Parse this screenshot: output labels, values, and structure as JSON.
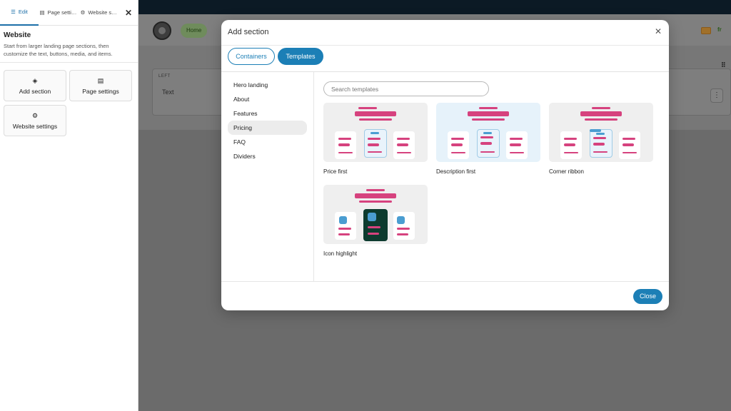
{
  "panel": {
    "tabs": [
      {
        "label": "Edit",
        "icon": "sliders-icon"
      },
      {
        "label": "Page settin...",
        "icon": "file-icon"
      },
      {
        "label": "Website set...",
        "icon": "gear-icon"
      }
    ],
    "close_label": "✕",
    "section_title": "Website",
    "section_desc": "Start from larger landing page sections, then customize the text, buttons, media, and items.",
    "actions": [
      {
        "label": "Add section",
        "icon": "layers-icon"
      },
      {
        "label": "Page settings",
        "icon": "file-icon"
      },
      {
        "label": "Website settings",
        "icon": "gear-icon"
      }
    ]
  },
  "page": {
    "nav_home": "Home",
    "lang": "fr",
    "section_tag": "LEFT",
    "section_text": "Text"
  },
  "modal": {
    "title": "Add section",
    "close_label": "✕",
    "tabs": [
      {
        "label": "Containers",
        "active": false
      },
      {
        "label": "Templates",
        "active": true
      }
    ],
    "categories": [
      {
        "label": "Hero landing",
        "active": false
      },
      {
        "label": "About",
        "active": false
      },
      {
        "label": "Features",
        "active": false
      },
      {
        "label": "Pricing",
        "active": true
      },
      {
        "label": "FAQ",
        "active": false
      },
      {
        "label": "Dividers",
        "active": false
      }
    ],
    "search_placeholder": "Search templates",
    "templates": [
      {
        "name": "Price first",
        "selected": false
      },
      {
        "name": "Description first",
        "selected": true
      },
      {
        "name": "Corner ribbon",
        "selected": false
      },
      {
        "name": "Icon highlight",
        "selected": false
      }
    ],
    "close_button": "Close"
  },
  "colors": {
    "accent": "#1c7fb6",
    "pink": "#d6427e",
    "dark_card": "#0d3b2f",
    "icon_blue": "#4a9dd1"
  }
}
